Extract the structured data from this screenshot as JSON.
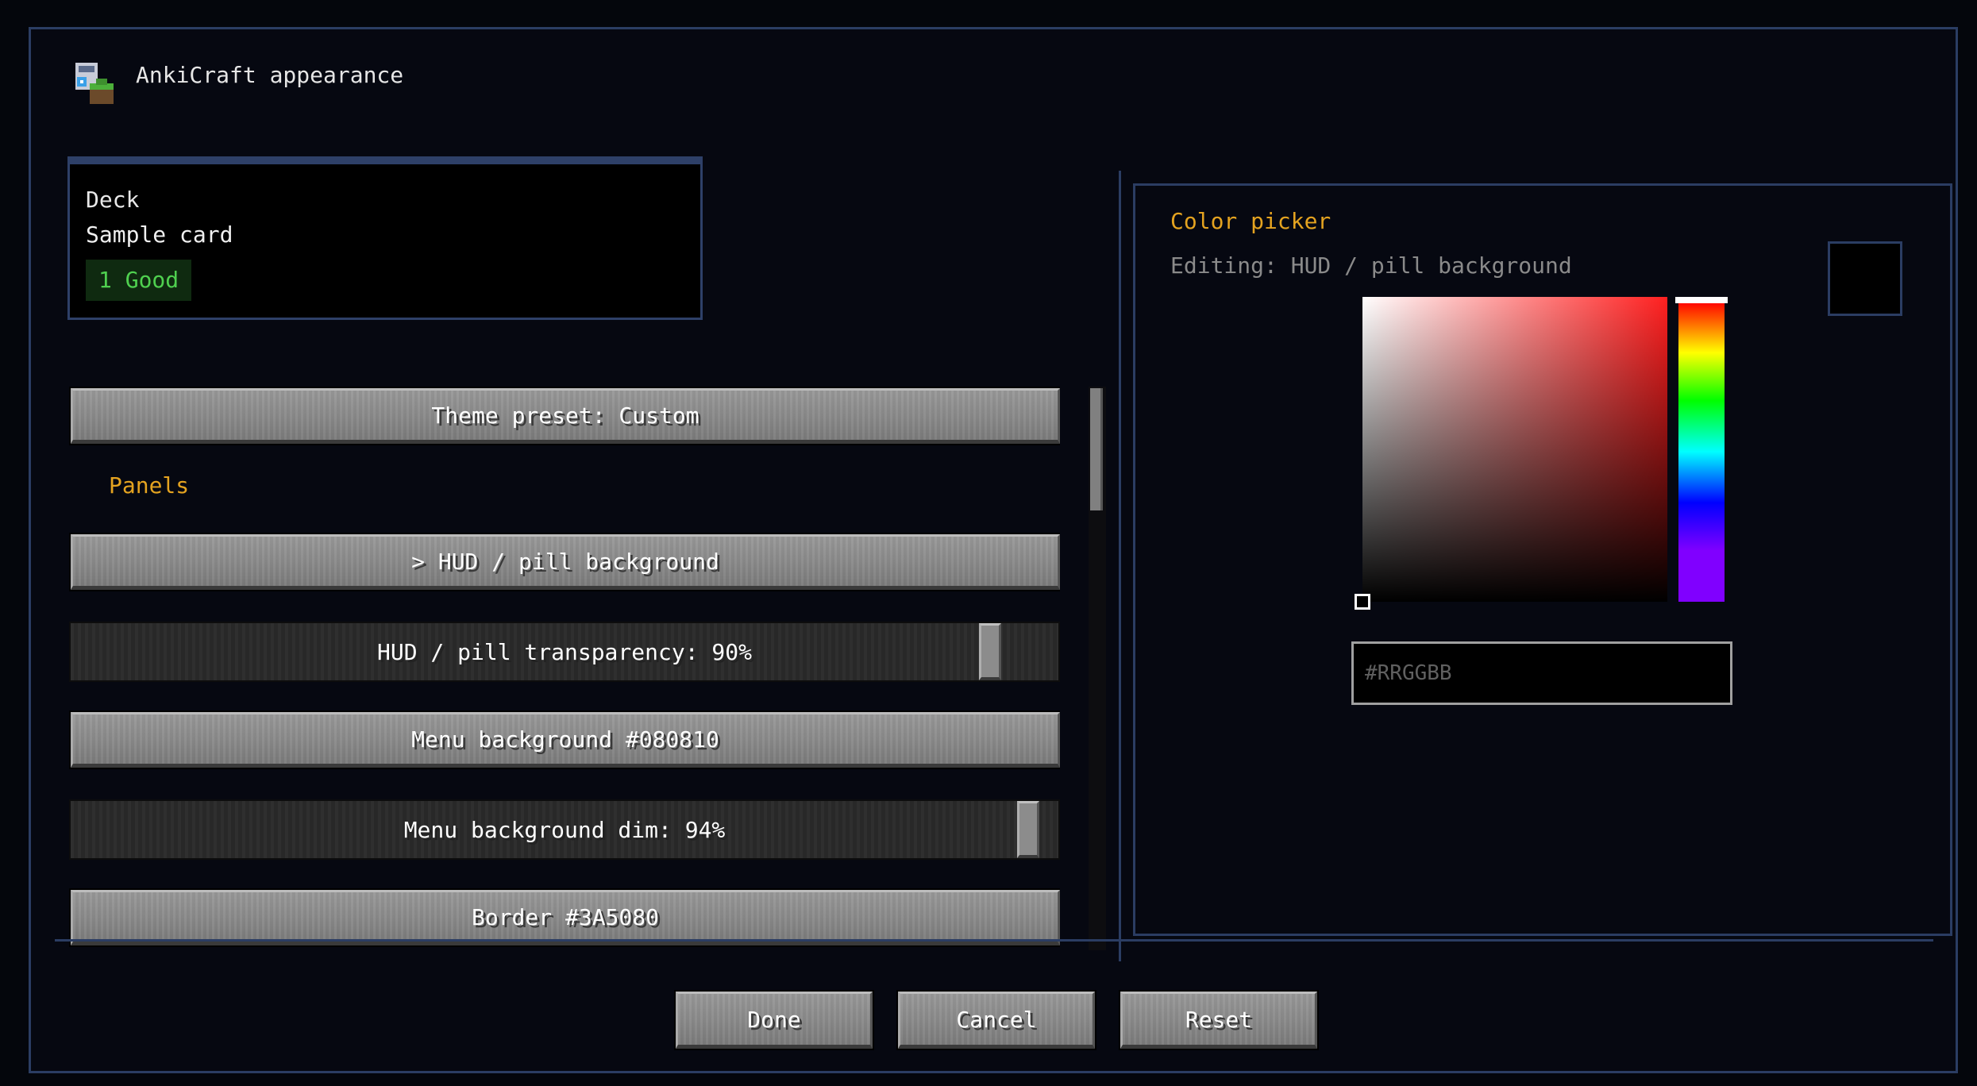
{
  "window": {
    "title": "AnkiCraft appearance",
    "icon": "ankicraft-app-icon"
  },
  "preview": {
    "deck": "Deck",
    "card": "Sample card",
    "pill": "1 Good",
    "pill_color": "#4fd04f"
  },
  "settings": {
    "theme_preset": "Theme preset: Custom",
    "section_panels": "Panels",
    "hud_pill_background": "> HUD / pill background",
    "hud_pill_transparency": {
      "label": "HUD / pill transparency: 90%",
      "value": 90
    },
    "menu_background": "Menu background  #080810",
    "menu_background_dim": {
      "label": "Menu background dim: 94%",
      "value": 94
    },
    "border": "Border  #3A5080"
  },
  "picker": {
    "title": "Color picker",
    "editing": "Editing: HUD / pill background",
    "hex_placeholder": "#RRGGBB",
    "hex_value": "",
    "swatch_color": "#000000",
    "hue_color": "#ff2020"
  },
  "buttons": {
    "done": "Done",
    "cancel": "Cancel",
    "reset": "Reset"
  },
  "colors": {
    "accent": "#e4a320",
    "border": "#2b3d63",
    "background": "#060811"
  }
}
